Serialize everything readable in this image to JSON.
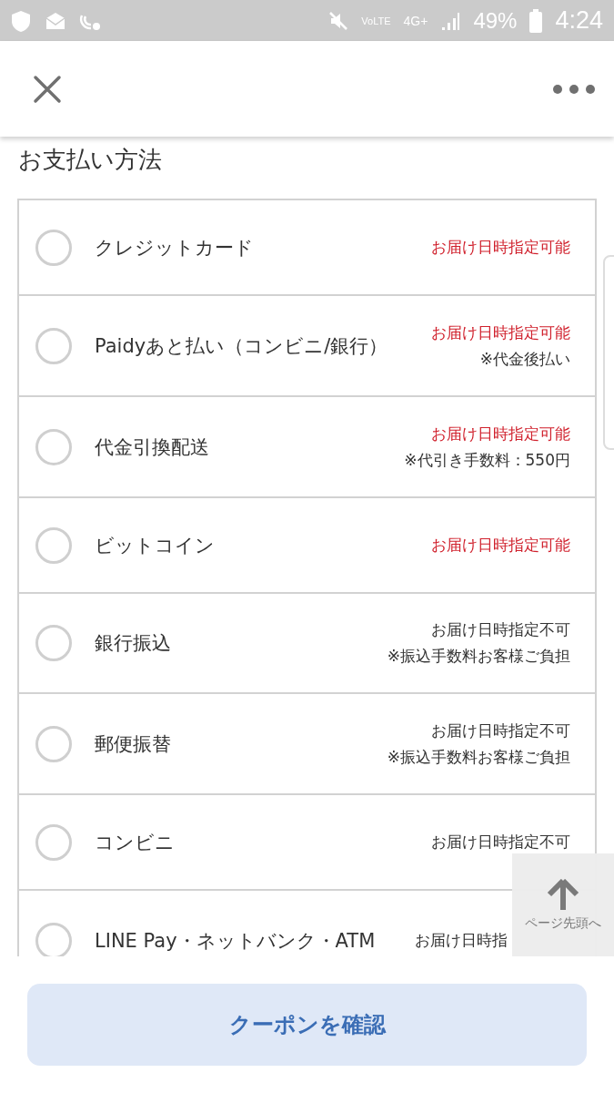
{
  "status_bar": {
    "volte": "VoLTE",
    "network": "4G+",
    "battery": "49%",
    "time": "4:24"
  },
  "section_title": "お支払い方法",
  "payment_methods": [
    {
      "name": "クレジットカード",
      "selected": false,
      "available": true,
      "availability": "お届け日時指定可能"
    },
    {
      "name": "Paidyあと払い（コンビニ/銀行）",
      "selected": false,
      "available": true,
      "availability": "お届け日時指定可能",
      "note": "※代金後払い"
    },
    {
      "name": "代金引換配送",
      "selected": false,
      "available": true,
      "availability": "お届け日時指定可能",
      "note": "※代引き手数料：550円"
    },
    {
      "name": "ビットコイン",
      "selected": false,
      "available": true,
      "availability": "お届け日時指定可能"
    },
    {
      "name": "銀行振込",
      "selected": false,
      "available": false,
      "availability": "お届け日時指定不可",
      "note": "※振込手数料お客様ご負担"
    },
    {
      "name": "郵便振替",
      "selected": false,
      "available": false,
      "availability": "お届け日時指定不可",
      "note": "※振込手数料お客様ご負担"
    },
    {
      "name": "コンビニ",
      "selected": false,
      "available": false,
      "availability": "お届け日時指定不可"
    },
    {
      "name": "LINE Pay・ネットバンク・ATM",
      "selected": false,
      "available": false,
      "availability": "お届け日時指"
    }
  ],
  "back_to_top": {
    "label": "ページ先頭へ"
  },
  "confirm_button": {
    "label": "クーポンを確認"
  }
}
